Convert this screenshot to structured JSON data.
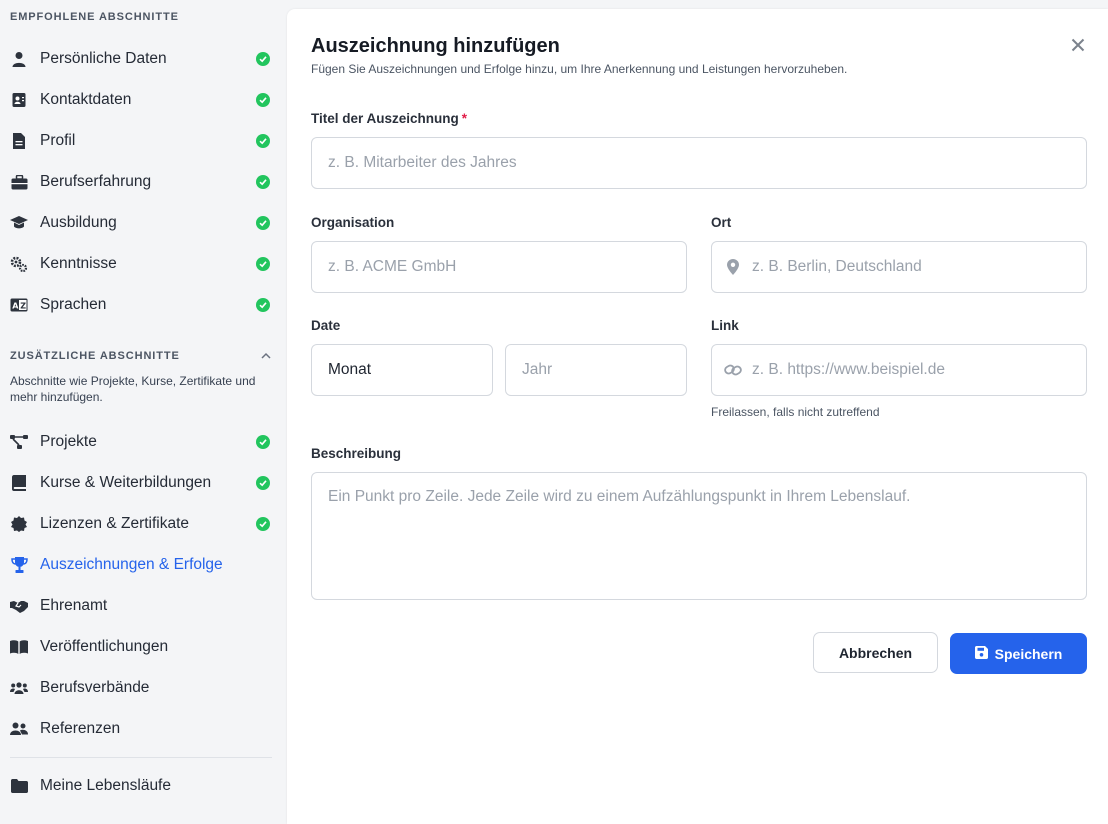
{
  "sidebar": {
    "recommended_heading": "EMPFOHLENE ABSCHNITTE",
    "recommended": [
      {
        "label": "Persönliche Daten",
        "icon": "user-icon",
        "done": true
      },
      {
        "label": "Kontaktdaten",
        "icon": "contact-card-icon",
        "done": true
      },
      {
        "label": "Profil",
        "icon": "document-icon",
        "done": true
      },
      {
        "label": "Berufserfahrung",
        "icon": "briefcase-icon",
        "done": true
      },
      {
        "label": "Ausbildung",
        "icon": "graduation-cap-icon",
        "done": true
      },
      {
        "label": "Kenntnisse",
        "icon": "gears-icon",
        "done": true
      },
      {
        "label": "Sprachen",
        "icon": "language-icon",
        "done": true
      }
    ],
    "additional_heading": "ZUSÄTZLICHE ABSCHNITTE",
    "additional_description": "Abschnitte wie Projekte, Kurse, Zertifikate und mehr hinzufügen.",
    "additional": [
      {
        "label": "Projekte",
        "icon": "project-diagram-icon",
        "done": true
      },
      {
        "label": "Kurse & Weiterbildungen",
        "icon": "book-icon",
        "done": true
      },
      {
        "label": "Lizenzen & Zertifikate",
        "icon": "certificate-icon",
        "done": true
      },
      {
        "label": "Auszeichnungen & Erfolge",
        "icon": "trophy-icon",
        "done": false,
        "active": true
      },
      {
        "label": "Ehrenamt",
        "icon": "handshake-icon",
        "done": false
      },
      {
        "label": "Veröffentlichungen",
        "icon": "open-book-icon",
        "done": false
      },
      {
        "label": "Berufsverbände",
        "icon": "users-icon",
        "done": false
      },
      {
        "label": "Referenzen",
        "icon": "people-icon",
        "done": false
      }
    ],
    "footer_item": {
      "label": "Meine Lebensläufe",
      "icon": "folder-icon"
    }
  },
  "dialog": {
    "title": "Auszeichnung hinzufügen",
    "subtitle": "Fügen Sie Auszeichnungen und Erfolge hinzu, um Ihre Anerkennung und Leistungen hervorzuheben.",
    "title_field": {
      "label": "Titel der Auszeichnung",
      "required_mark": "*",
      "placeholder": "z. B. Mitarbeiter des Jahres"
    },
    "organisation": {
      "label": "Organisation",
      "placeholder": "z. B. ACME GmbH"
    },
    "location": {
      "label": "Ort",
      "placeholder": "z. B. Berlin, Deutschland"
    },
    "date": {
      "label": "Date",
      "month_value": "Monat",
      "year_placeholder": "Jahr"
    },
    "link": {
      "label": "Link",
      "placeholder": "z. B. https://www.beispiel.de",
      "hint": "Freilassen, falls nicht zutreffend"
    },
    "description": {
      "label": "Beschreibung",
      "placeholder": "Ein Punkt pro Zeile. Jede Zeile wird zu einem Aufzählungspunkt in Ihrem Lebenslauf."
    },
    "cancel_label": "Abbrechen",
    "save_label": "Speichern"
  },
  "colors": {
    "accent": "#2563eb",
    "success": "#22c55e",
    "required": "#e11d48"
  }
}
